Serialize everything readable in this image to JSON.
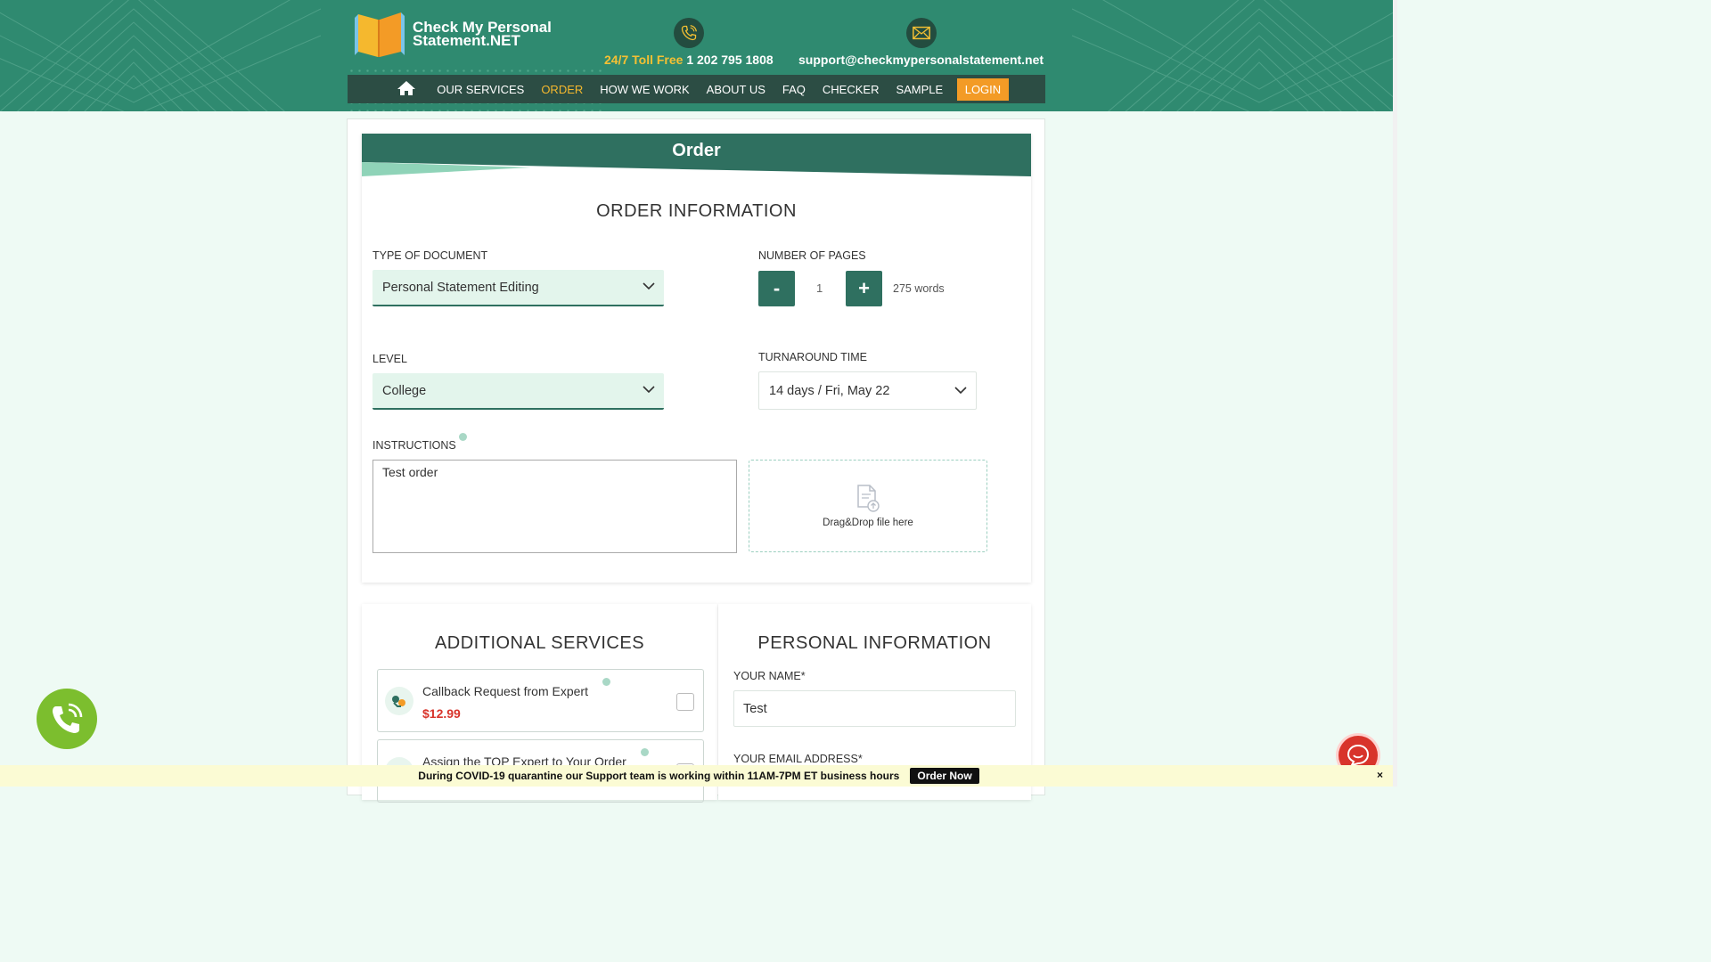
{
  "header": {
    "logo": {
      "line1": "Check My Personal",
      "line2": "Statement.NET"
    },
    "phone": {
      "prefix": "24/7 Toll Free",
      "number": "1 202 795 1808",
      "icon": "phone-icon"
    },
    "email": {
      "address": "support@checkmypersonalstatement.net",
      "icon": "envelope-icon"
    },
    "nav": {
      "items": [
        "OUR SERVICES",
        "ORDER",
        "HOW WE WORK",
        "ABOUT US",
        "FAQ",
        "CHECKER",
        "SAMPLE"
      ],
      "active": "ORDER",
      "login": "LOGIN"
    }
  },
  "order": {
    "heading": "Order",
    "section_title": "ORDER INFORMATION",
    "type_label": "TYPE OF DOCUMENT",
    "type_value": "Personal Statement Editing",
    "pages_label": "NUMBER OF PAGES",
    "minus": "-",
    "plus": "+",
    "pages_value": "1",
    "words": "275 words",
    "level_label": "LEVEL",
    "level_value": "College",
    "turnaround_label": "TURNAROUND TIME",
    "turnaround_value": "14 days / Fri, May 22",
    "instructions_label": "INSTRUCTIONS",
    "instructions_value": "Test order",
    "drop_label": "Drag&Drop file here"
  },
  "additional": {
    "title": "ADDITIONAL SERVICES",
    "services": [
      {
        "name": "Callback Request from Expert",
        "price": "$12.99",
        "checked": false
      },
      {
        "name": "Assign the TOP Expert to Your Order",
        "price": "",
        "checked": false
      }
    ]
  },
  "personal": {
    "title": "PERSONAL INFORMATION",
    "name_label": "YOUR NAME*",
    "name_value": "Test",
    "email_label": "YOUR EMAIL ADDRESS*"
  },
  "banner": {
    "text": "During COVID-19 quarantine our Support team is working within 11AM-7PM ET business hours",
    "button": "Order Now",
    "close": "×"
  },
  "colors": {
    "brand": "#2f8a70",
    "dark": "#2c4d44",
    "accent": "#f5b82e",
    "price": "#d8342b"
  }
}
